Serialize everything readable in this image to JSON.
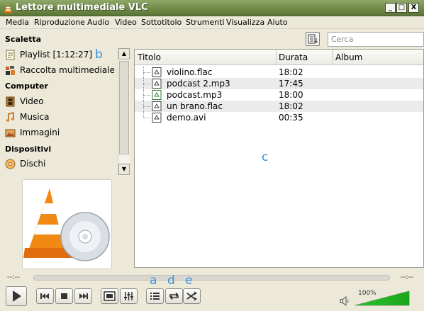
{
  "window": {
    "title": "Lettore multimediale VLC",
    "minimize": "_",
    "maximize": "□",
    "close": "X"
  },
  "menu": [
    "Media",
    "Riproduzione",
    "Audio",
    "Video",
    "Sottotitolo",
    "Strumenti",
    "Visualizza",
    "Aiuto"
  ],
  "sidebar": {
    "section_scaletta": "Scaletta",
    "playlist_label": "Playlist [1:12:27]",
    "media_library": "Raccolta multimediale",
    "section_computer": "Computer",
    "video": "Video",
    "music": "Musica",
    "images": "Immagini",
    "section_devices": "Dispositivi",
    "discs": "Dischi"
  },
  "search": {
    "placeholder": "Cerca"
  },
  "playlist": {
    "columns": {
      "title": "Titolo",
      "duration": "Durata",
      "album": "Album"
    },
    "rows": [
      {
        "title": "violino.flac",
        "duration": "18:02"
      },
      {
        "title": "podcast 2.mp3",
        "duration": "17:45"
      },
      {
        "title": "podcast.mp3",
        "duration": "18:00"
      },
      {
        "title": "un brano.flac",
        "duration": "18:02"
      },
      {
        "title": "demo.avi",
        "duration": "00:35"
      }
    ]
  },
  "seek": {
    "elapsed": "--:--",
    "remaining": "--:--"
  },
  "volume": {
    "percent": "100%",
    "level": 1.0
  },
  "annotations": {
    "b": "b",
    "c": "c",
    "a": "a",
    "d": "d",
    "e": "e"
  }
}
